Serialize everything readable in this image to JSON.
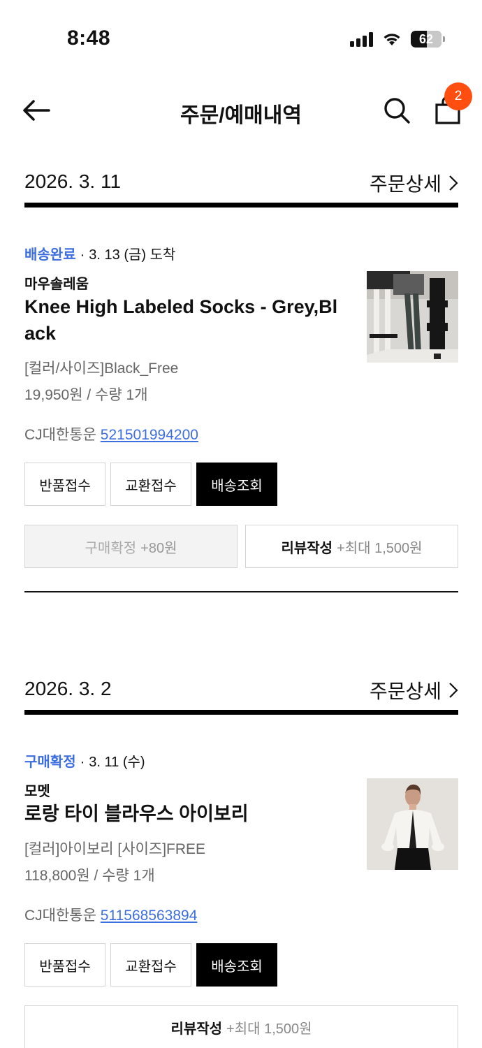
{
  "status_bar": {
    "time": "8:48",
    "battery": "62",
    "battery_level": 0.62
  },
  "header": {
    "title": "주문/예매내역",
    "cart_count": "2",
    "back_icon": "arrow-left-icon",
    "search_icon": "search-icon",
    "bag_icon": "shopping-bag-icon"
  },
  "accent_colors": {
    "link_blue": "#3d6ee0",
    "badge_orange": "#ff4e10"
  },
  "orders": [
    {
      "date": "2026. 3. 11",
      "detail_label": "주문상세",
      "status": "배송완료",
      "status_dot": "·",
      "status_detail": "3. 13 (금) 도착",
      "brand": "마우솔레움",
      "product_name": "Knee High Labeled Socks - Grey,Black",
      "option": "[컬러/사이즈]Black_Free",
      "price": "19,950원 / 수량 1개",
      "carrier": "CJ대한통운",
      "tracking": "521501994200",
      "buttons": [
        "반품접수",
        "교환접수",
        "배송조회"
      ],
      "confirm": {
        "label": "구매확정",
        "reward": "+80원"
      },
      "review": {
        "label": "리뷰작성",
        "reward": "+최대 1,500원"
      }
    },
    {
      "date": "2026. 3. 2",
      "detail_label": "주문상세",
      "status": "구매확정",
      "status_dot": "·",
      "status_detail": "3. 11 (수)",
      "brand": "모멧",
      "product_name": "로랑 타이 블라우스 아이보리",
      "option": "[컬러]아이보리 [사이즈]FREE",
      "price": "118,800원 / 수량 1개",
      "carrier": "CJ대한통운",
      "tracking": "511568563894",
      "buttons": [
        "반품접수",
        "교환접수",
        "배송조회"
      ],
      "review": {
        "label": "리뷰작성",
        "reward": "+최대 1,500원"
      }
    }
  ]
}
